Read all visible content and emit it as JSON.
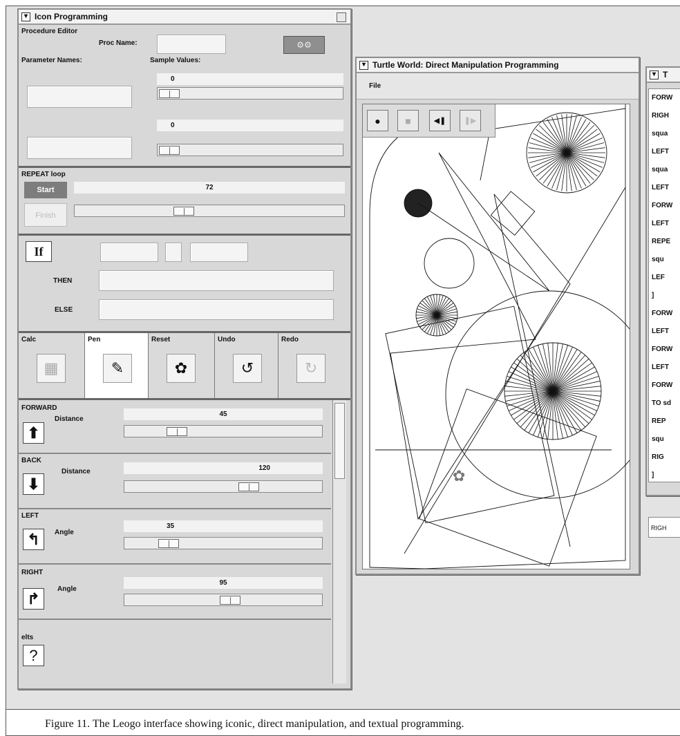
{
  "caption": "Figure 11. The Leogo interface showing iconic, direct manipulation, and textual programming.",
  "icon_window": {
    "title": "Icon Programming",
    "procedure_editor": {
      "label": "Procedure Editor",
      "proc_name_label": "Proc Name:",
      "proc_name_value": "",
      "run_button_glyph": "⚙⚙",
      "parameter_names_label": "Parameter Names:",
      "sample_values_label": "Sample Values:",
      "parameters": [
        {
          "name": "",
          "value": "0",
          "fraction": 0.0
        },
        {
          "name": "",
          "value": "0",
          "fraction": 0.0
        }
      ]
    },
    "repeat": {
      "label": "REPEAT loop",
      "start_label": "Start",
      "finish_label": "Finish",
      "value": "72",
      "fraction": 0.38
    },
    "conditional": {
      "if_label": "If",
      "then_label": "THEN",
      "else_label": "ELSE",
      "operator": "",
      "left": "",
      "right": "",
      "then_value": "",
      "else_value": ""
    },
    "tools": [
      {
        "label": "Calc",
        "icon": "calculator-icon",
        "glyph": "▦"
      },
      {
        "label": "Pen",
        "icon": "pen-icon",
        "glyph": "✎"
      },
      {
        "label": "Reset",
        "icon": "turtle-icon",
        "glyph": "✿"
      },
      {
        "label": "Undo",
        "icon": "undo-icon",
        "glyph": "↺"
      },
      {
        "label": "Redo",
        "icon": "redo-icon",
        "glyph": "↻"
      }
    ],
    "commands": [
      {
        "label": "FORWARD",
        "param_label": "Distance",
        "value": "45",
        "fraction": 0.22,
        "glyph": "⬆",
        "icon": "arrow-up-icon"
      },
      {
        "label": "BACK",
        "param_label": "Distance",
        "value": "120",
        "fraction": 0.58,
        "glyph": "⬇",
        "icon": "arrow-down-icon"
      },
      {
        "label": "LEFT",
        "param_label": "Angle",
        "value": "35",
        "fraction": 0.18,
        "glyph": "↰",
        "icon": "turn-left-icon"
      },
      {
        "label": "RIGHT",
        "param_label": "Angle",
        "value": "95",
        "fraction": 0.48,
        "glyph": "↱",
        "icon": "turn-right-icon"
      }
    ],
    "misc": {
      "label": "elts",
      "glyph": "?"
    }
  },
  "turtle_window": {
    "title": "Turtle World: Direct Manipulation Programming",
    "menu_file": "File",
    "controls": [
      {
        "name": "record-button",
        "glyph": "●"
      },
      {
        "name": "stop-button",
        "glyph": "■"
      },
      {
        "name": "step-back-button",
        "glyph": "◀❚"
      },
      {
        "name": "step-forward-button",
        "glyph": "❚▶"
      }
    ]
  },
  "text_window": {
    "title": "T",
    "lines": [
      "FORW",
      "RIGH",
      "squa",
      "LEFT",
      "squa",
      "LEFT",
      "FORW",
      "LEFT",
      "REPE",
      "  squ",
      "  LEF",
      "]",
      "FORW",
      "LEFT",
      "FORW",
      "LEFT",
      "FORW",
      "TO sd",
      "  REP",
      "  squ",
      "  RIG",
      "  ]"
    ],
    "input_value": "RIGH"
  }
}
